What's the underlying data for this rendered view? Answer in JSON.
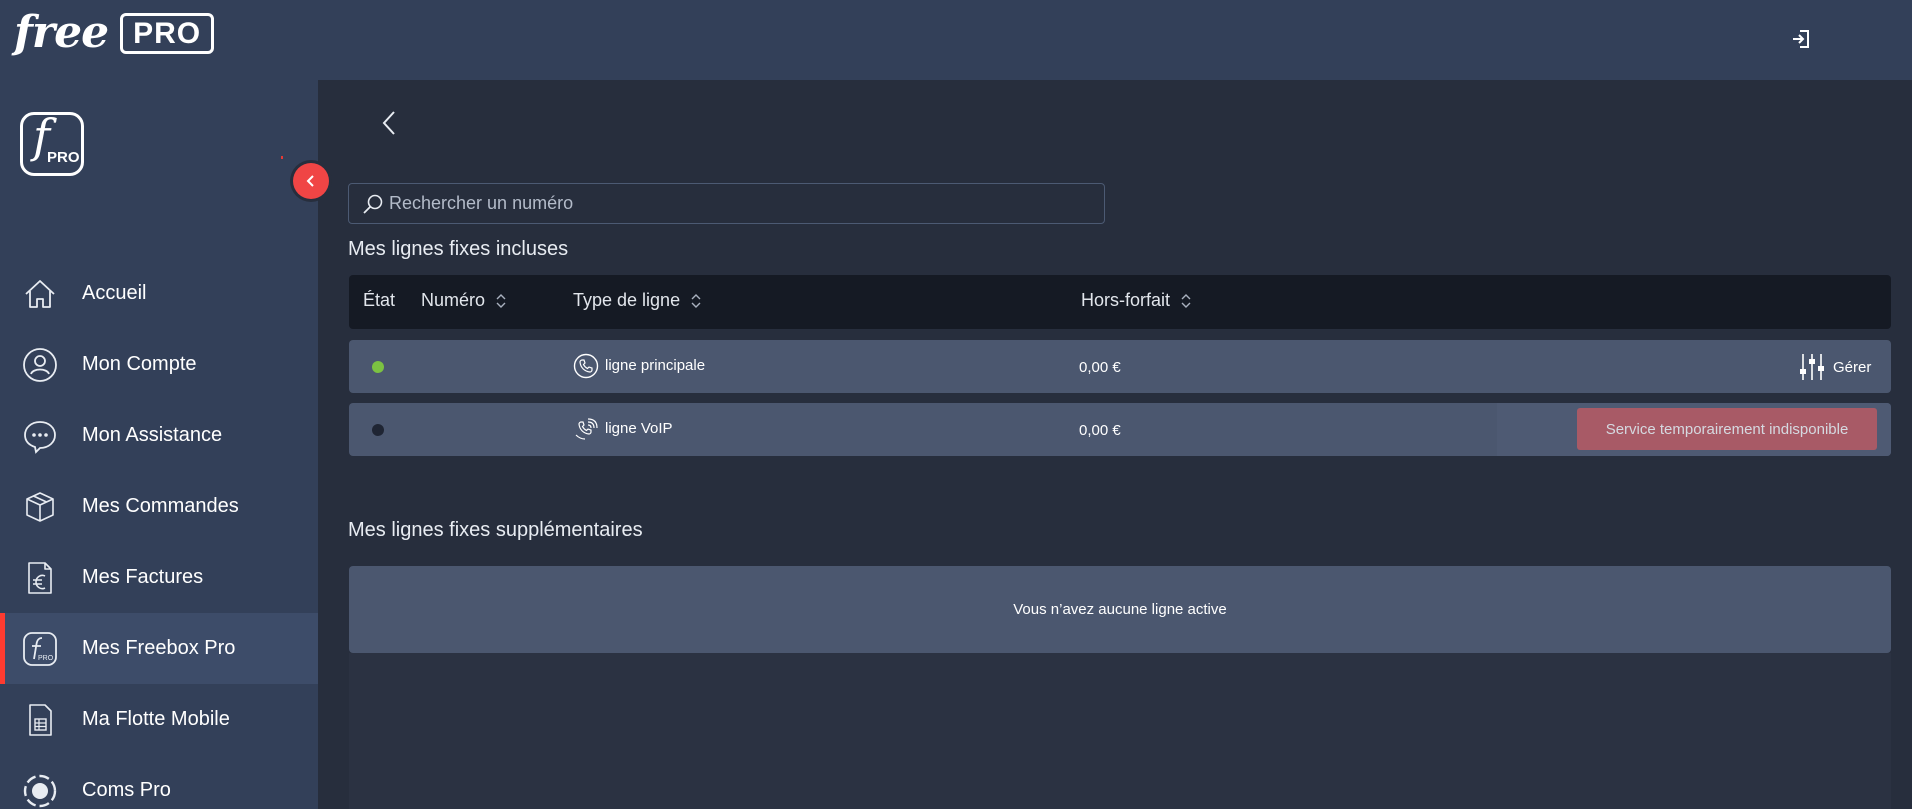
{
  "header": {
    "logo_word": "free",
    "logo_badge": "PRO",
    "logout_icon": "logout-icon"
  },
  "sidebar": {
    "logo_letter": "f",
    "logo_text": "PRO",
    "collapse_icon": "chevron-left-icon",
    "items": [
      {
        "label": "Accueil",
        "icon": "home-icon",
        "active": false
      },
      {
        "label": "Mon Compte",
        "icon": "user-icon",
        "active": false
      },
      {
        "label": "Mon Assistance",
        "icon": "chat-icon",
        "active": false
      },
      {
        "label": "Mes Commandes",
        "icon": "box-icon",
        "active": false
      },
      {
        "label": "Mes Factures",
        "icon": "invoice-euro-icon",
        "active": false
      },
      {
        "label": "Mes Freebox Pro",
        "icon": "freebox-pro-icon",
        "active": true
      },
      {
        "label": "Ma Flotte Mobile",
        "icon": "sim-card-icon",
        "active": false
      },
      {
        "label": "Coms Pro",
        "icon": "coms-pro-icon",
        "active": false
      }
    ]
  },
  "search": {
    "placeholder": "Rechercher un numéro",
    "value": ""
  },
  "included": {
    "title": "Mes lignes fixes incluses",
    "columns": [
      "État",
      "Numéro",
      "Type de ligne",
      "Hors-forfait"
    ],
    "rows": [
      {
        "status_color": "#7cc242",
        "number": "",
        "type": "ligne principale",
        "type_icon": "phone-icon",
        "amount": "0,00 €",
        "action": "Gérer"
      },
      {
        "status_color": "#1f2533",
        "number": "",
        "type": "ligne VoIP",
        "type_icon": "voip-phone-icon",
        "amount": "0,00 €",
        "action": "Service temporairement indisponible"
      }
    ]
  },
  "extra": {
    "title": "Mes lignes fixes supplémentaires",
    "empty_text": "Vous n’avez aucune ligne active"
  },
  "colors": {
    "accent_red": "#f04545",
    "status_active": "#7cc242",
    "status_inactive": "#1f2533"
  }
}
